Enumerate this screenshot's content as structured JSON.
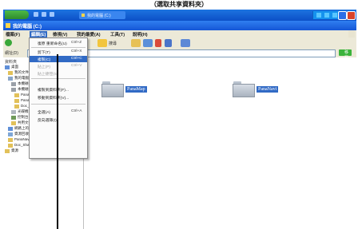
{
  "caption": "（選取共享資料夾）",
  "taskbar": {
    "task_label": "我的電腦 (C:)"
  },
  "window": {
    "title": "我的電腦 (C:)"
  },
  "menubar": {
    "items": [
      {
        "label": "檔案(F)"
      },
      {
        "label": "編輯(E)"
      },
      {
        "label": "檢視(V)"
      },
      {
        "label": "我的最愛(A)"
      },
      {
        "label": "工具(T)"
      },
      {
        "label": "說明(H)"
      }
    ],
    "active_index": 1
  },
  "toolbar": {
    "search_label": "搜尋",
    "folders_label": "資料夾"
  },
  "addressbar": {
    "label": "網址(D)",
    "go_label": "移至"
  },
  "sidebar": {
    "header": "資料夾",
    "items": [
      {
        "label": "桌面"
      },
      {
        "label": "我的文件"
      },
      {
        "label": "我的電腦"
      },
      {
        "label": "本機磁碟 (C:)"
      },
      {
        "label": "本機磁碟 (D:)"
      },
      {
        "label": "PanaMap"
      },
      {
        "label": "PanaNavi"
      },
      {
        "label": "Doc_Share"
      },
      {
        "label": "光碟機 (E:)"
      },
      {
        "label": "控制台"
      },
      {
        "label": "共用文件"
      },
      {
        "label": "網路上的芳鄰"
      },
      {
        "label": "資源回收筒"
      },
      {
        "label": "PanaNavigate"
      },
      {
        "label": "Doc_Share"
      },
      {
        "label": "資源"
      }
    ]
  },
  "dropdown": {
    "items": [
      {
        "label": "復原 重新命名(U)",
        "shortcut": "Ctrl+Z"
      },
      {
        "label": "剪下(T)",
        "shortcut": "Ctrl+X"
      },
      {
        "label": "複製(C)",
        "shortcut": "Ctrl+C"
      },
      {
        "label": "貼上(P)",
        "shortcut": "Ctrl+V"
      },
      {
        "label": "貼上捷徑(S)",
        "shortcut": ""
      },
      {
        "label": "複製到資料夾(F)...",
        "shortcut": ""
      },
      {
        "label": "移動到資料夾(V)...",
        "shortcut": ""
      },
      {
        "label": "全選(A)",
        "shortcut": "Ctrl+A"
      },
      {
        "label": "反向選擇(I)",
        "shortcut": ""
      }
    ],
    "highlighted_index": 2
  },
  "folders": [
    {
      "name": "PanaMap"
    },
    {
      "name": "PanaNavi"
    }
  ],
  "colors": {
    "xp_blue": "#1556d6",
    "selection": "#316ac5",
    "start_green": "#2f8c2c"
  }
}
